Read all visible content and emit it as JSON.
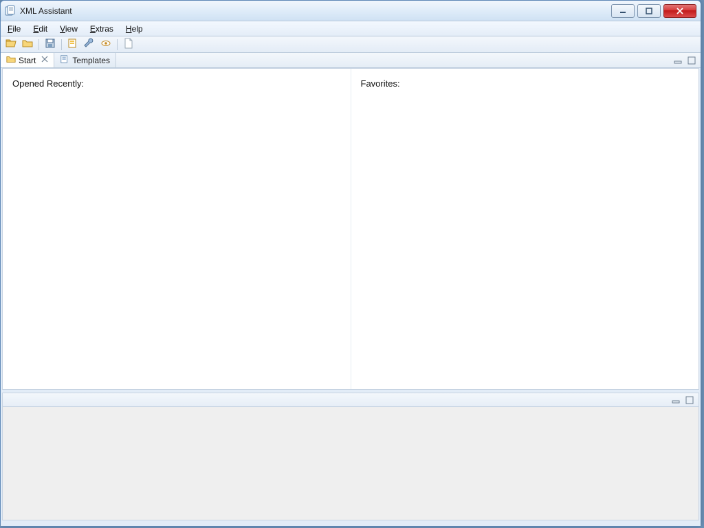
{
  "window": {
    "title": "XML Assistant"
  },
  "menubar": {
    "items": [
      {
        "label": "File",
        "accel": "F"
      },
      {
        "label": "Edit",
        "accel": "E"
      },
      {
        "label": "View",
        "accel": "V"
      },
      {
        "label": "Extras",
        "accel": "E"
      },
      {
        "label": "Help",
        "accel": "H"
      }
    ]
  },
  "toolbar": {
    "buttons": [
      {
        "name": "open-folder",
        "icon": "open-folder-icon"
      },
      {
        "name": "open-archive",
        "icon": "folder-closed-icon"
      },
      {
        "sep": true
      },
      {
        "name": "save",
        "icon": "save-icon"
      },
      {
        "sep": true
      },
      {
        "name": "validate",
        "icon": "validate-icon"
      },
      {
        "name": "transform",
        "icon": "wrench-icon"
      },
      {
        "name": "preview",
        "icon": "eye-icon"
      },
      {
        "sep": true
      },
      {
        "name": "new-document",
        "icon": "document-icon"
      }
    ]
  },
  "tabs": [
    {
      "label": "Start",
      "icon": "folder-tab-icon",
      "active": true,
      "closable": true
    },
    {
      "label": "Templates",
      "icon": "templates-tab-icon",
      "active": false,
      "closable": false
    }
  ],
  "start_pane": {
    "left_header": "Opened Recently:",
    "right_header": "Favorites:",
    "recent_items": [],
    "favorite_items": []
  }
}
